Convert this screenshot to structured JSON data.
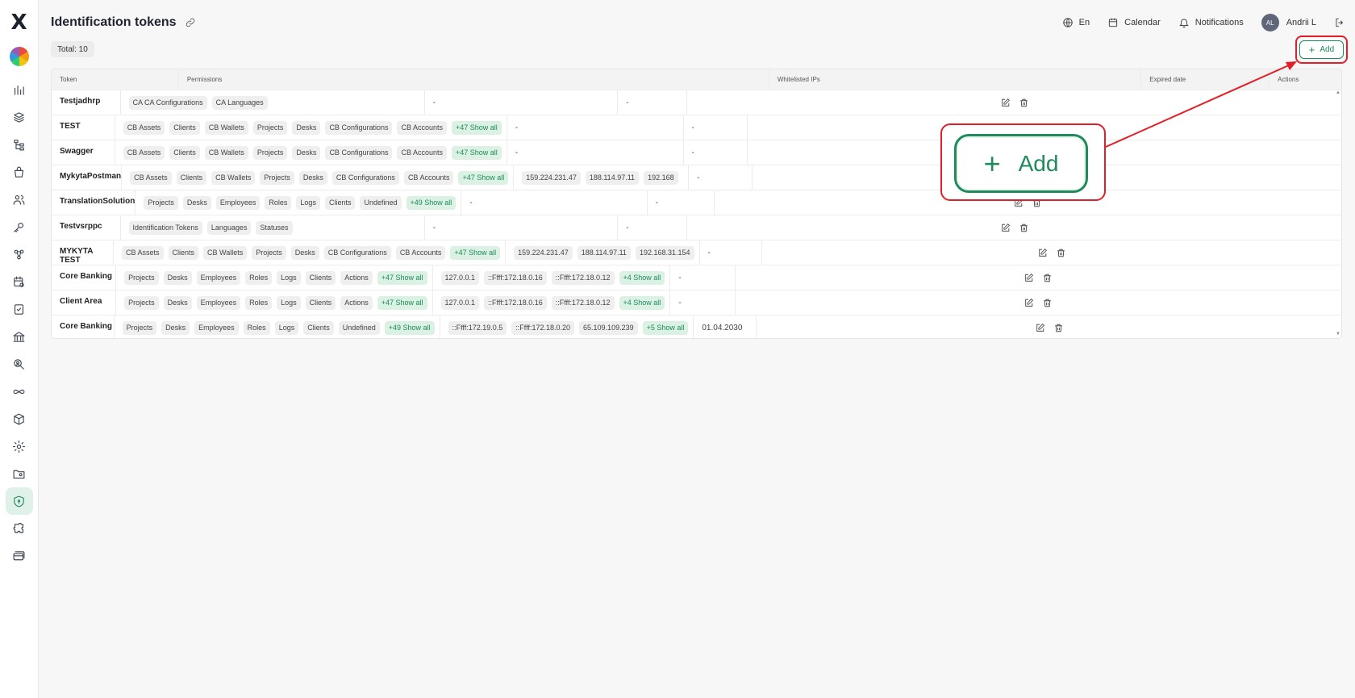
{
  "header": {
    "title": "Identification tokens",
    "language": "En",
    "calendar": "Calendar",
    "notifications": "Notifications",
    "user_initials": "AL",
    "user_name": "Andrii L"
  },
  "total_label": "Total: 10",
  "add_button": {
    "label": "Add",
    "zoom_label": "Add"
  },
  "columns": [
    "Token",
    "Permissions",
    "Whitelisted IPs",
    "Expired date",
    "Actions"
  ],
  "rows": [
    {
      "token": "Testjadhrp",
      "permissions": [
        "CA CA Configurations",
        "CA Languages"
      ],
      "more": "",
      "ips": [],
      "ips_more": "",
      "ips_dash": "-",
      "expired": "-"
    },
    {
      "token": "TEST",
      "permissions": [
        "CB Assets",
        "Clients",
        "CB Wallets",
        "Projects",
        "Desks",
        "CB Configurations",
        "CB Accounts"
      ],
      "more": "+47 Show all",
      "ips": [],
      "ips_more": "",
      "ips_dash": "-",
      "expired": "-"
    },
    {
      "token": "Swagger",
      "permissions": [
        "CB Assets",
        "Clients",
        "CB Wallets",
        "Projects",
        "Desks",
        "CB Configurations",
        "CB Accounts"
      ],
      "more": "+47 Show all",
      "ips": [],
      "ips_more": "",
      "ips_dash": "-",
      "expired": "-"
    },
    {
      "token": "MykytaPostman",
      "permissions": [
        "CB Assets",
        "Clients",
        "CB Wallets",
        "Projects",
        "Desks",
        "CB Configurations",
        "CB Accounts"
      ],
      "more": "+47 Show all",
      "ips": [
        "159.224.231.47",
        "188.114.97.11",
        "192.168"
      ],
      "ips_more": "",
      "ips_dash": "",
      "expired": "-"
    },
    {
      "token": "TranslationSolution",
      "permissions": [
        "Projects",
        "Desks",
        "Employees",
        "Roles",
        "Logs",
        "Clients",
        "Undefined"
      ],
      "more": "+49 Show all",
      "ips": [],
      "ips_more": "",
      "ips_dash": "-",
      "expired": "-"
    },
    {
      "token": "Testvsrppc",
      "permissions": [
        "Identification Tokens",
        "Languages",
        "Statuses"
      ],
      "more": "",
      "ips": [],
      "ips_more": "",
      "ips_dash": "-",
      "expired": "-"
    },
    {
      "token": "MYKYTA TEST",
      "permissions": [
        "CB Assets",
        "Clients",
        "CB Wallets",
        "Projects",
        "Desks",
        "CB Configurations",
        "CB Accounts"
      ],
      "more": "+47 Show all",
      "ips": [
        "159.224.231.47",
        "188.114.97.11",
        "192.168.31.154"
      ],
      "ips_more": "",
      "ips_dash": "",
      "expired": "-"
    },
    {
      "token": "Core Banking",
      "permissions": [
        "Projects",
        "Desks",
        "Employees",
        "Roles",
        "Logs",
        "Clients",
        "Actions"
      ],
      "more": "+47 Show all",
      "ips": [
        "127.0.0.1",
        "::Ffff:172.18.0.16",
        "::Ffff:172.18.0.12"
      ],
      "ips_more": "+4 Show all",
      "ips_dash": "",
      "expired": "-"
    },
    {
      "token": "Client Area",
      "permissions": [
        "Projects",
        "Desks",
        "Employees",
        "Roles",
        "Logs",
        "Clients",
        "Actions"
      ],
      "more": "+47 Show all",
      "ips": [
        "127.0.0.1",
        "::Ffff:172.18.0.16",
        "::Ffff:172.18.0.12"
      ],
      "ips_more": "+4 Show all",
      "ips_dash": "",
      "expired": "-"
    },
    {
      "token": "Core Banking",
      "permissions": [
        "Projects",
        "Desks",
        "Employees",
        "Roles",
        "Logs",
        "Clients",
        "Undefined"
      ],
      "more": "+49 Show all",
      "ips": [
        "::Ffff:172.19.0.5",
        "::Ffff:172.18.0.20",
        "65.109.109.239"
      ],
      "ips_more": "+5 Show all",
      "ips_dash": "",
      "expired": "01.04.2030"
    }
  ],
  "sidebar_icons": [
    "analytics-icon",
    "layers-icon",
    "hierarchy-icon",
    "basket-icon",
    "users-icon",
    "key-icon",
    "network-icon",
    "calendar-settings-icon",
    "document-check-icon",
    "bank-icon",
    "user-search-icon",
    "infinity-icon",
    "package-icon",
    "gear-icon",
    "folder-user-icon",
    "shield-icon",
    "puzzle-icon",
    "cards-icon"
  ],
  "colors": {
    "accent": "#1f8a5b",
    "highlight": "#e21f26",
    "chip_more_bg": "#dbf1e4"
  }
}
